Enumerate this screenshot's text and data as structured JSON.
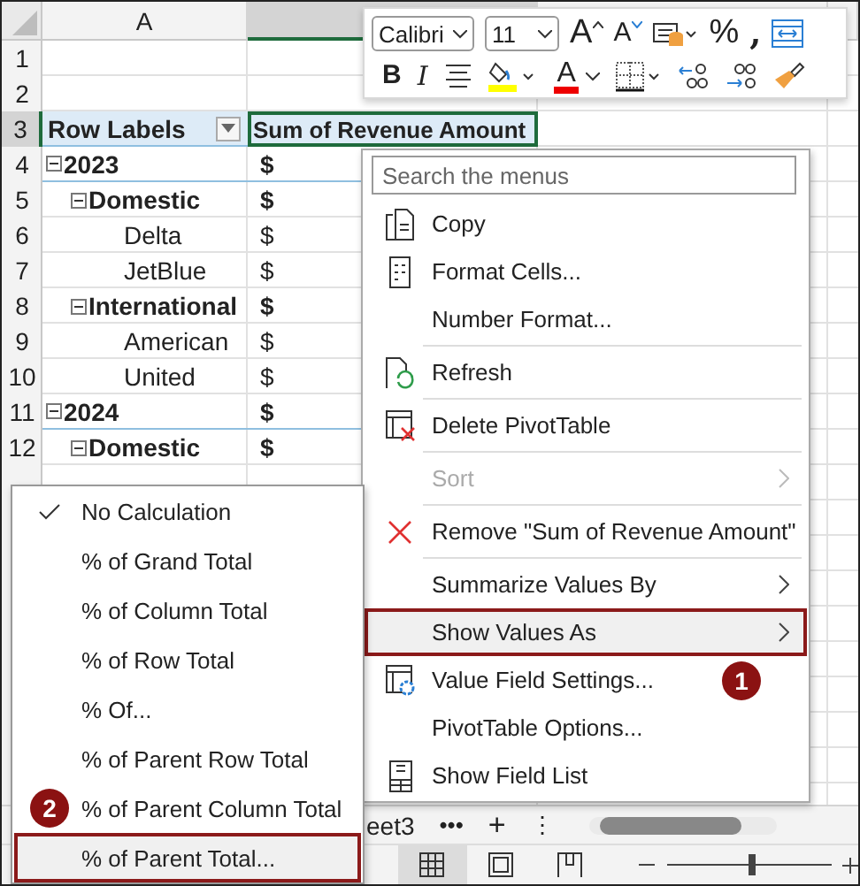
{
  "sheet": {
    "column_headers": [
      "A"
    ],
    "row_numbers": [
      "1",
      "2",
      "3",
      "4",
      "5",
      "6",
      "7",
      "8",
      "9",
      "10",
      "11",
      "12"
    ],
    "pivot_header": {
      "row_labels": "Row Labels",
      "values": "Sum of Revenue Amount"
    },
    "pivot": [
      {
        "label": "2023",
        "value": "$",
        "expanded": true,
        "children": [
          {
            "label": "Domestic",
            "value": "$",
            "expanded": true,
            "children": [
              {
                "label": "Delta",
                "value": "$"
              },
              {
                "label": "JetBlue",
                "value": "$"
              }
            ]
          },
          {
            "label": "International",
            "value": "$",
            "expanded": true,
            "children": [
              {
                "label": "American",
                "value": "$"
              },
              {
                "label": "United",
                "value": "$"
              }
            ]
          }
        ]
      },
      {
        "label": "2024",
        "value": "$",
        "expanded": true,
        "children": [
          {
            "label": "Domestic",
            "value": "$",
            "expanded": true
          }
        ]
      }
    ]
  },
  "toolbar": {
    "font": "Calibri",
    "size": "11",
    "grow": "A",
    "shrink": "A",
    "percent": "%",
    "comma": ",",
    "bold": "B",
    "italic": "I",
    "font_color": "A"
  },
  "context_menu": {
    "search": {
      "placeholder": "Search the menus"
    },
    "items": [
      {
        "kind": "item",
        "label": "Copy",
        "disabled": false,
        "submenu": false,
        "selected": false
      },
      {
        "kind": "item",
        "label": "Format Cells...",
        "disabled": false,
        "submenu": false,
        "selected": false
      },
      {
        "kind": "item",
        "label": "Number Format...",
        "disabled": false,
        "submenu": false,
        "selected": false
      },
      {
        "kind": "separator"
      },
      {
        "kind": "item",
        "label": "Refresh",
        "disabled": false,
        "submenu": false,
        "selected": false
      },
      {
        "kind": "separator"
      },
      {
        "kind": "item",
        "label": "Delete PivotTable",
        "disabled": false,
        "submenu": false,
        "selected": false
      },
      {
        "kind": "separator"
      },
      {
        "kind": "item",
        "label": "Sort",
        "disabled": true,
        "submenu": true,
        "selected": false
      },
      {
        "kind": "separator"
      },
      {
        "kind": "item",
        "label": "Remove \"Sum of Revenue Amount\"",
        "disabled": false,
        "submenu": false,
        "selected": false
      },
      {
        "kind": "separator"
      },
      {
        "kind": "item",
        "label": "Summarize Values By",
        "disabled": false,
        "submenu": true,
        "selected": false
      },
      {
        "kind": "item",
        "label": "Show Values As",
        "disabled": false,
        "submenu": true,
        "selected": true
      },
      {
        "kind": "item",
        "label": "Value Field Settings...",
        "disabled": false,
        "submenu": false,
        "selected": false,
        "badge": "1"
      },
      {
        "kind": "item",
        "label": "PivotTable Options...",
        "disabled": false,
        "submenu": false,
        "selected": false
      },
      {
        "kind": "item",
        "label": "Show Field List",
        "disabled": false,
        "submenu": false,
        "selected": false
      }
    ]
  },
  "submenu": [
    {
      "label": "No Calculation",
      "checked": true,
      "selected": false
    },
    {
      "label": "% of Grand Total",
      "checked": false,
      "selected": false
    },
    {
      "label": "% of Column Total",
      "checked": false,
      "selected": false
    },
    {
      "label": "% of Row Total",
      "checked": false,
      "selected": false
    },
    {
      "label": "% Of...",
      "checked": false,
      "selected": false
    },
    {
      "label": "% of Parent Row Total",
      "checked": false,
      "selected": false
    },
    {
      "label": "% of Parent Column Total",
      "checked": false,
      "selected": false,
      "badge": "2"
    },
    {
      "label": "% of Parent Total...",
      "checked": false,
      "selected": true
    }
  ],
  "sheet_tabs": {
    "tab": "eet3",
    "more": "•••",
    "add": "+",
    "options": "⋮"
  },
  "status_bar": {
    "zoom": {
      "level": 0.5
    }
  }
}
